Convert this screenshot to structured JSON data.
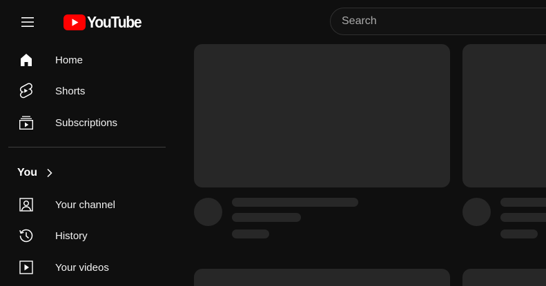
{
  "header": {
    "logo_text": "YouTube",
    "search_placeholder": "Search"
  },
  "sidebar": {
    "items": [
      {
        "label": "Home",
        "icon": "home-icon"
      },
      {
        "label": "Shorts",
        "icon": "shorts-icon"
      },
      {
        "label": "Subscriptions",
        "icon": "subscriptions-icon"
      }
    ],
    "you_section": {
      "title": "You",
      "items": [
        {
          "label": "Your channel",
          "icon": "your-channel-icon"
        },
        {
          "label": "History",
          "icon": "history-icon"
        },
        {
          "label": "Your videos",
          "icon": "your-videos-icon"
        }
      ]
    }
  },
  "colors": {
    "background": "#0f0f0f",
    "skeleton": "#272727",
    "brand_red": "#ff0000",
    "text": "#f1f1f1",
    "placeholder": "#aaaaaa"
  }
}
